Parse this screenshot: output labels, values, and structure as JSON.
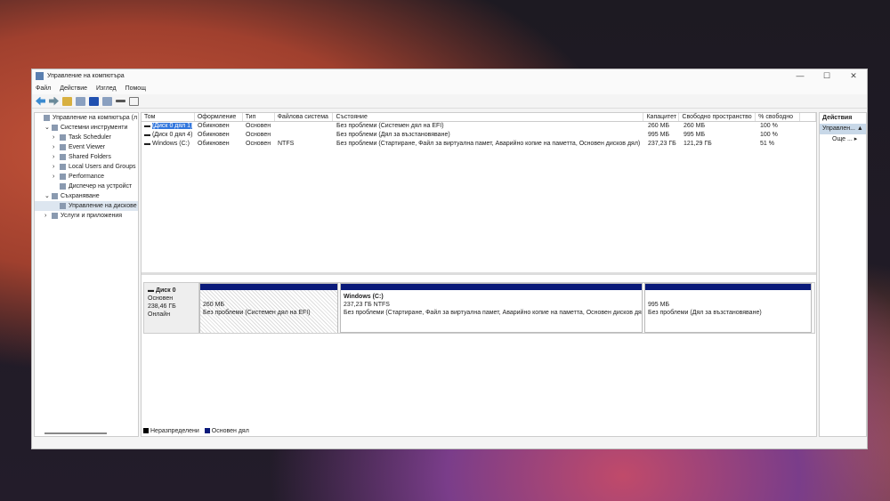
{
  "window": {
    "title": "Управление на компютъра",
    "min": "—",
    "max": "☐",
    "close": "✕"
  },
  "menu": [
    "Файл",
    "Действие",
    "Изглед",
    "Помощ"
  ],
  "tree": [
    {
      "label": "Управление на компютъра (л",
      "indent": 0,
      "exp": ""
    },
    {
      "label": "Системни инструменти",
      "indent": 1,
      "exp": "⌄"
    },
    {
      "label": "Task Scheduler",
      "indent": 2,
      "exp": "›"
    },
    {
      "label": "Event Viewer",
      "indent": 2,
      "exp": "›"
    },
    {
      "label": "Shared Folders",
      "indent": 2,
      "exp": "›"
    },
    {
      "label": "Local Users and Groups",
      "indent": 2,
      "exp": "›"
    },
    {
      "label": "Performance",
      "indent": 2,
      "exp": "›"
    },
    {
      "label": "Диспечер на устройст",
      "indent": 2,
      "exp": ""
    },
    {
      "label": "Съхраняване",
      "indent": 1,
      "exp": "⌄"
    },
    {
      "label": "Управление на дискове",
      "indent": 2,
      "exp": ""
    },
    {
      "label": "Услуги и приложения",
      "indent": 1,
      "exp": "›"
    }
  ],
  "columns": [
    "Том",
    "Оформление",
    "Тип",
    "Файлова система",
    "Състояние",
    "Капацитет",
    "Свободно пространство",
    "% свободно",
    ""
  ],
  "rows": [
    [
      "(Диск 0 дял 1)",
      "Обикновен",
      "Основен",
      "",
      "Без проблеми (Системен дял на EFI)",
      "260 МБ",
      "260 МБ",
      "100 %"
    ],
    [
      "(Диск 0 дял 4)",
      "Обикновен",
      "Основен",
      "",
      "Без проблеми (Дял за възстановяване)",
      "995 МБ",
      "995 МБ",
      "100 %"
    ],
    [
      "Windows (C:)",
      "Обикновен",
      "Основен",
      "NTFS",
      "Без проблеми (Стартиране, Файл за виртуална памет, Аварийно копие на паметта, Основен дисков дял)",
      "237,23 ГБ",
      "121,29 ГБ",
      "51 %"
    ]
  ],
  "disk": {
    "name": "Диск 0",
    "type": "Основен",
    "size": "238,46 ГБ",
    "status": "Онлайн",
    "partitions": [
      {
        "title": "",
        "size": "260 МБ",
        "status": "Без проблеми (Системен дял на EFI)"
      },
      {
        "title": "Windows  (C:)",
        "size": "237,23 ГБ NTFS",
        "status": "Без проблеми (Стартиране, Файл за виртуална памет, Аварийно копие на паметта, Основен дисков дял)"
      },
      {
        "title": "",
        "size": "995 МБ",
        "status": "Без проблеми (Дял за възстановяване)"
      }
    ]
  },
  "legend": [
    {
      "label": "Неразпределени",
      "color": "#000000"
    },
    {
      "label": "Основен дял",
      "color": "#0a1a7a"
    }
  ],
  "actions": {
    "header": "Действия",
    "section": "Управлен...",
    "more": "Още ..."
  }
}
